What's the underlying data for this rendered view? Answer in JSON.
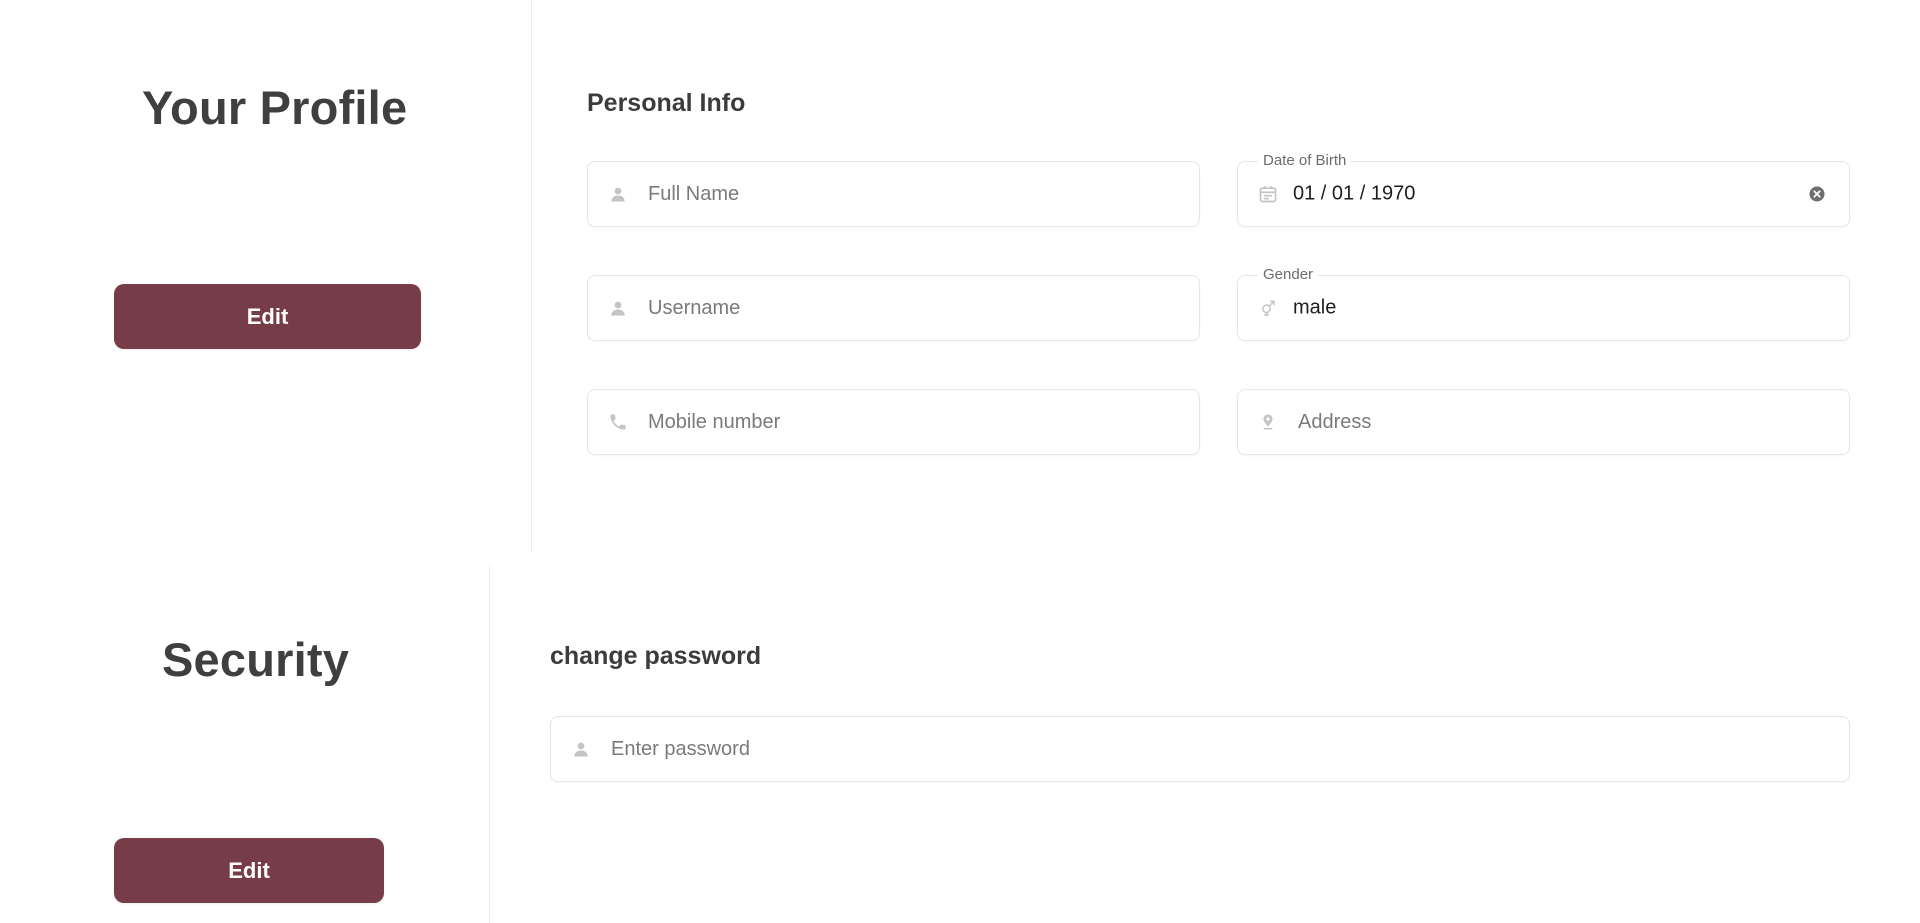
{
  "profile": {
    "title": "Your Profile",
    "edit_label": "Edit",
    "personal_info": {
      "heading": "Personal Info",
      "full_name": {
        "placeholder": "Full Name",
        "value": "",
        "icon": "person-icon"
      },
      "date_of_birth": {
        "label": "Date of Birth",
        "value": "01 / 01 / 1970",
        "icon": "calendar-icon",
        "clear_icon": "clear-circle-icon"
      },
      "username": {
        "placeholder": "Username",
        "value": "",
        "icon": "person-icon"
      },
      "gender": {
        "label": "Gender",
        "value": "male",
        "icon": "gender-icon"
      },
      "mobile": {
        "placeholder": "Mobile number",
        "value": "",
        "icon": "phone-icon"
      },
      "address": {
        "placeholder": "Address",
        "value": "",
        "icon": "location-pin-icon"
      }
    }
  },
  "security": {
    "title": "Security",
    "edit_label": "Edit",
    "change_password": {
      "heading": "change password",
      "password": {
        "placeholder": "Enter password",
        "value": "",
        "icon": "person-icon"
      }
    }
  },
  "colors": {
    "accent": "#763d48",
    "text_dark": "#3f3f3f",
    "border": "#e6e6e6",
    "icon_gray": "#c4c4c4"
  }
}
